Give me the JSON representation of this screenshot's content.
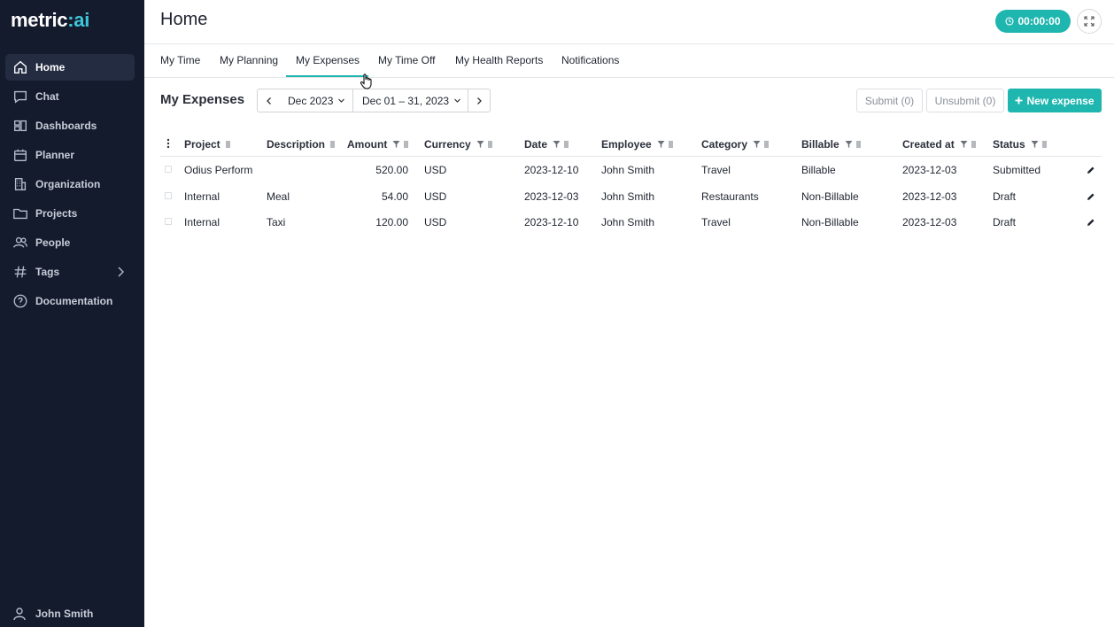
{
  "sidebar": {
    "logo_main": "metric",
    "logo_accent": ":ai",
    "items": [
      {
        "label": "Home",
        "icon": "home-icon"
      },
      {
        "label": "Chat",
        "icon": "chat-icon"
      },
      {
        "label": "Dashboards",
        "icon": "dashboard-icon"
      },
      {
        "label": "Planner",
        "icon": "calendar-icon"
      },
      {
        "label": "Organization",
        "icon": "building-icon"
      },
      {
        "label": "Projects",
        "icon": "folder-icon"
      },
      {
        "label": "People",
        "icon": "people-icon"
      },
      {
        "label": "Tags",
        "icon": "hash-icon"
      },
      {
        "label": "Documentation",
        "icon": "help-icon"
      }
    ],
    "active": "Home",
    "user": "John Smith"
  },
  "header": {
    "title": "Home",
    "timer": "00:00:00"
  },
  "tabs": {
    "items": [
      "My Time",
      "My Planning",
      "My Expenses",
      "My Time Off",
      "My Health Reports",
      "Notifications"
    ],
    "active": "My Expenses"
  },
  "toolbar": {
    "title": "My Expenses",
    "month": "Dec 2023",
    "range": "Dec 01 – 31, 2023",
    "submit": "Submit (0)",
    "unsubmit": "Unsubmit (0)",
    "new_expense": "New expense"
  },
  "table": {
    "columns": [
      "Project",
      "Description",
      "Amount",
      "Currency",
      "Date",
      "Employee",
      "Category",
      "Billable",
      "Created at",
      "Status"
    ],
    "rows": [
      {
        "project": "Odius Perform",
        "description": "",
        "amount": "520.00",
        "currency": "USD",
        "date": "2023-12-10",
        "employee": "John Smith",
        "category": "Travel",
        "billable": "Billable",
        "created_at": "2023-12-03",
        "status": "Submitted"
      },
      {
        "project": "Internal",
        "description": "Meal",
        "amount": "54.00",
        "currency": "USD",
        "date": "2023-12-03",
        "employee": "John Smith",
        "category": "Restaurants",
        "billable": "Non-Billable",
        "created_at": "2023-12-03",
        "status": "Draft"
      },
      {
        "project": "Internal",
        "description": "Taxi",
        "amount": "120.00",
        "currency": "USD",
        "date": "2023-12-10",
        "employee": "John Smith",
        "category": "Travel",
        "billable": "Non-Billable",
        "created_at": "2023-12-03",
        "status": "Draft"
      }
    ]
  },
  "colors": {
    "sidebar_bg": "#141b2d",
    "accent": "#1fb6b0"
  }
}
